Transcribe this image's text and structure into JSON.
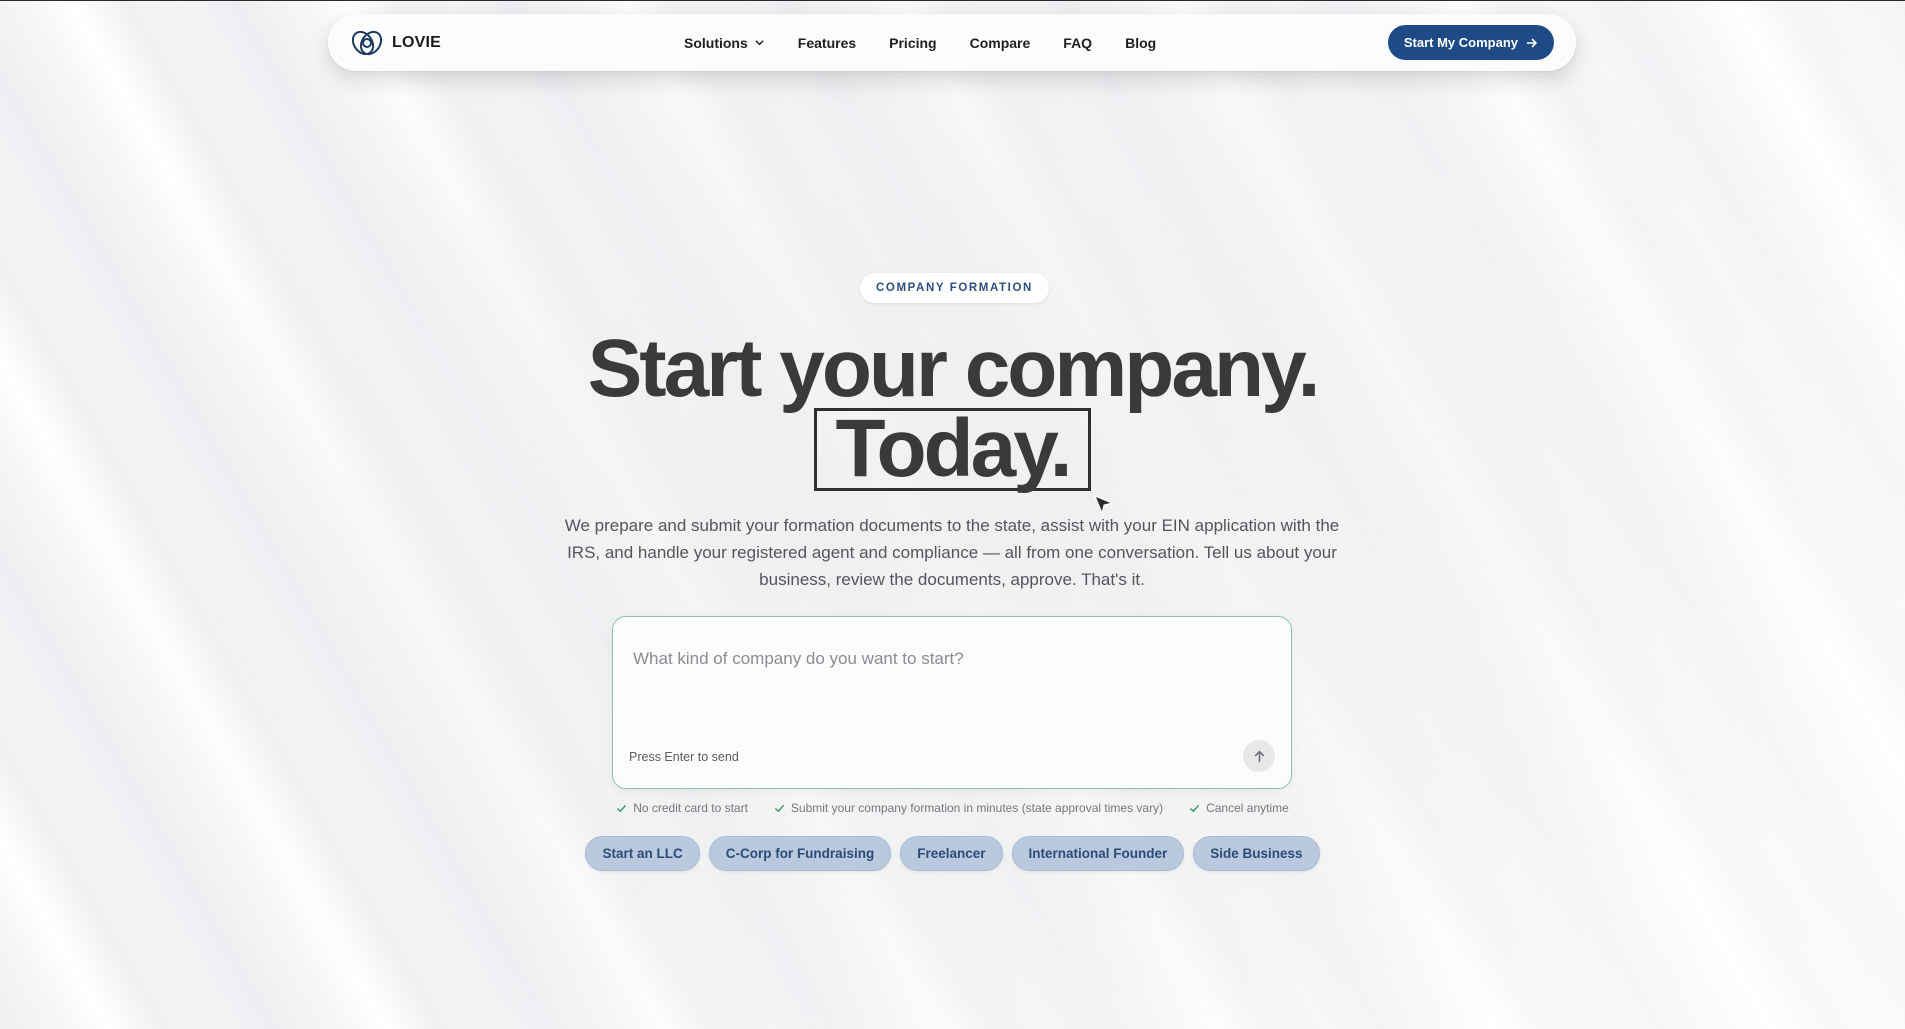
{
  "brand": {
    "name": "LOVIE",
    "icon": "interlocking-rings-logo"
  },
  "nav": {
    "items": [
      {
        "label": "Solutions",
        "has_dropdown": true
      },
      {
        "label": "Features"
      },
      {
        "label": "Pricing"
      },
      {
        "label": "Compare"
      },
      {
        "label": "FAQ"
      },
      {
        "label": "Blog"
      }
    ],
    "cta_label": "Start My Company"
  },
  "hero": {
    "badge": "COMPANY FORMATION",
    "headline_line1": "Start your company.",
    "headline_line2": "Today.",
    "subtext": "We prepare and submit your formation documents to the state, assist with your EIN application with the IRS, and handle your registered agent and compliance — all from one conversation. Tell us about your business, review the documents, approve. That's it."
  },
  "chat": {
    "placeholder": "What kind of company do you want to start?",
    "value": "",
    "hint": "Press Enter to send",
    "send_icon": "arrow-up-icon"
  },
  "perks": [
    "No credit card to start",
    "Submit your company formation in minutes (state approval times vary)",
    "Cancel anytime"
  ],
  "chips": [
    "Start an LLC",
    "C-Corp for Fundraising",
    "Freelancer",
    "International Founder",
    "Side Business"
  ],
  "colors": {
    "primary": "#1e4a86",
    "chip_bg": "#b9c9de",
    "chip_text": "#2c4c78",
    "input_border": "#8fc2ad",
    "check": "#3a9a63"
  }
}
